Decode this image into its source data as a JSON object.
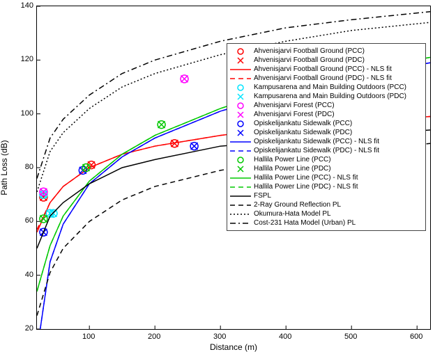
{
  "chart_data": {
    "type": "line",
    "xlabel": "Distance (m)",
    "ylabel": "Path Loss (dB)",
    "xlim": [
      20,
      620
    ],
    "ylim": [
      20,
      140
    ],
    "xticks": [
      100,
      200,
      300,
      400,
      500,
      600
    ],
    "yticks": [
      20,
      40,
      60,
      80,
      100,
      120,
      140
    ],
    "legend_entries": [
      "Ahvenisjarvi Football Ground (PCC)",
      "Ahvenisjarvi Football Ground (PDC)",
      "Ahvenisjarvi Football Ground (PCC) - NLS fit",
      "Ahvenisjarvi Football Ground (PDC) - NLS fit",
      "Kampusarena and Main Building Outdoors (PCC)",
      "Kampusarena and Main Building Outdoors (PDC)",
      "Ahvenisjarvi Forest (PCC)",
      "Ahvenisjarvi Forest (PDC)",
      "Opiskelijankatu Sidewalk (PCC)",
      "Opiskelijankatu Sidewalk (PDC)",
      "Opiskelijankatu Sidewalk (PCC) - NLS fit",
      "Opiskelijankatu Sidewalk (PDC) - NLS fit",
      "Hallila Power Line (PCC)",
      "Hallila Power Line (PDC)",
      "Hallila Power Line (PCC) - NLS fit",
      "Hallila Power Line (PDC) - NLS fit",
      "FSPL",
      "2-Ray Ground Reflection PL",
      "Okumura-Hata Model PL",
      "Cost-231 Hata Model (Urban) PL"
    ],
    "series": [
      {
        "name": "Ahvenisjarvi Football Ground (PCC)",
        "kind": "marker",
        "marker": "o",
        "color": "#ff0000",
        "x": [
          30,
          103,
          230,
          455
        ],
        "y": [
          69,
          81,
          89,
          97
        ]
      },
      {
        "name": "Ahvenisjarvi Football Ground (PDC)",
        "kind": "marker",
        "marker": "x",
        "color": "#ff0000",
        "x": [
          30,
          103,
          230,
          455
        ],
        "y": [
          69,
          81,
          89,
          97
        ]
      },
      {
        "name": "Ahvenisjarvi Football Ground (PCC) - NLS fit",
        "kind": "line",
        "dash": "solid",
        "color": "#ff0000",
        "x": [
          20,
          40,
          60,
          100,
          150,
          200,
          300,
          400,
          500,
          620
        ],
        "y": [
          56,
          67,
          73,
          80,
          85,
          88,
          92,
          95,
          97,
          99
        ]
      },
      {
        "name": "Ahvenisjarvi Football Ground (PDC) - NLS fit",
        "kind": "line",
        "dash": "dash",
        "color": "#ff0000",
        "x": [
          20,
          40,
          60,
          100,
          150,
          200,
          300,
          400,
          500,
          620
        ],
        "y": [
          57,
          67,
          73,
          80,
          85,
          88,
          92,
          95,
          97,
          99
        ]
      },
      {
        "name": "Kampusarena and Main Building Outdoors (PCC)",
        "kind": "marker",
        "marker": "o",
        "color": "#00e5ff",
        "x": [
          30,
          40,
          45
        ],
        "y": [
          70,
          63,
          63
        ]
      },
      {
        "name": "Kampusarena and Main Building Outdoors (PDC)",
        "kind": "marker",
        "marker": "x",
        "color": "#00e5ff",
        "x": [
          30,
          40,
          45
        ],
        "y": [
          70,
          63,
          63
        ]
      },
      {
        "name": "Ahvenisjarvi Forest (PCC)",
        "kind": "marker",
        "marker": "o",
        "color": "#ff00ff",
        "x": [
          30,
          245
        ],
        "y": [
          71,
          113
        ]
      },
      {
        "name": "Ahvenisjarvi Forest (PDC)",
        "kind": "marker",
        "marker": "x",
        "color": "#ff00ff",
        "x": [
          30,
          245
        ],
        "y": [
          71,
          113
        ]
      },
      {
        "name": "Opiskelijankatu Sidewalk (PCC)",
        "kind": "marker",
        "marker": "o",
        "color": "#0000ff",
        "x": [
          30,
          90,
          260,
          470,
          600
        ],
        "y": [
          56,
          79,
          88,
          116,
          118
        ]
      },
      {
        "name": "Opiskelijankatu Sidewalk (PDC)",
        "kind": "marker",
        "marker": "x",
        "color": "#0000ff",
        "x": [
          30,
          90,
          260,
          470,
          600
        ],
        "y": [
          56,
          79,
          88,
          116,
          118
        ]
      },
      {
        "name": "Opiskelijankatu Sidewalk (PCC) - NLS fit",
        "kind": "line",
        "dash": "solid",
        "color": "#0000ff",
        "x": [
          25,
          40,
          60,
          100,
          150,
          200,
          300,
          400,
          500,
          620
        ],
        "y": [
          20,
          45,
          59,
          74,
          84,
          91,
          101,
          108,
          114,
          119
        ]
      },
      {
        "name": "Opiskelijankatu Sidewalk (PDC) - NLS fit",
        "kind": "line",
        "dash": "dash",
        "color": "#0000ff",
        "x": [
          25,
          40,
          60,
          100,
          150,
          200,
          300,
          400,
          500,
          620
        ],
        "y": [
          20,
          45,
          59,
          74,
          84,
          91,
          101,
          108,
          114,
          119
        ]
      },
      {
        "name": "Hallila Power Line (PCC)",
        "kind": "marker",
        "marker": "o",
        "color": "#00c800",
        "x": [
          30,
          95,
          210,
          400,
          605
        ],
        "y": [
          61,
          80,
          96,
          111,
          121
        ]
      },
      {
        "name": "Hallila Power Line (PDC)",
        "kind": "marker",
        "marker": "x",
        "color": "#00c800",
        "x": [
          30,
          95,
          210,
          400,
          605
        ],
        "y": [
          61,
          80,
          96,
          111,
          121
        ]
      },
      {
        "name": "Hallila Power Line (PCC) - NLS fit",
        "kind": "line",
        "dash": "solid",
        "color": "#00c800",
        "x": [
          20,
          40,
          60,
          100,
          150,
          200,
          300,
          400,
          500,
          620
        ],
        "y": [
          34,
          51,
          62,
          75,
          85,
          92,
          102,
          110,
          116,
          121
        ]
      },
      {
        "name": "Hallila Power Line (PDC) - NLS fit",
        "kind": "line",
        "dash": "dash",
        "color": "#00c800",
        "x": [
          20,
          40,
          60,
          100,
          150,
          200,
          300,
          400,
          500,
          620
        ],
        "y": [
          34,
          51,
          62,
          75,
          85,
          92,
          102,
          110,
          116,
          121
        ]
      },
      {
        "name": "FSPL",
        "kind": "line",
        "dash": "solid",
        "color": "#000000",
        "x": [
          20,
          40,
          60,
          100,
          150,
          200,
          300,
          400,
          500,
          620
        ],
        "y": [
          50,
          62,
          67,
          74,
          80,
          83,
          88,
          90,
          92,
          94
        ]
      },
      {
        "name": "2-Ray Ground Reflection PL",
        "kind": "line",
        "dash": "dash",
        "color": "#000000",
        "x": [
          20,
          40,
          60,
          100,
          150,
          200,
          300,
          400,
          500,
          620
        ],
        "y": [
          25,
          41,
          50,
          60,
          68,
          73,
          79,
          83,
          86,
          89
        ]
      },
      {
        "name": "Okumura-Hata Model PL",
        "kind": "line",
        "dash": "dot",
        "color": "#000000",
        "x": [
          20,
          40,
          60,
          100,
          150,
          200,
          300,
          400,
          500,
          620
        ],
        "y": [
          71,
          86,
          93,
          102,
          110,
          115,
          122,
          127,
          131,
          134
        ]
      },
      {
        "name": "Cost-231 Hata Model (Urban) PL",
        "kind": "line",
        "dash": "dashdot",
        "color": "#000000",
        "x": [
          20,
          40,
          60,
          100,
          150,
          200,
          300,
          400,
          500,
          620
        ],
        "y": [
          76,
          91,
          98,
          107,
          115,
          120,
          127,
          132,
          135,
          138
        ]
      }
    ]
  }
}
